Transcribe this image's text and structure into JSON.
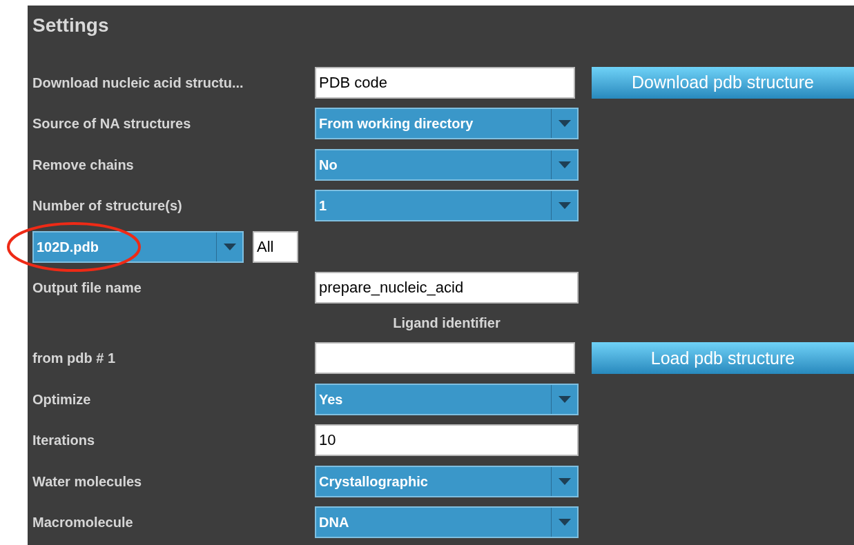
{
  "title": "Settings",
  "rows": [
    {
      "kind": "text",
      "label": "Download nucleic acid structu...",
      "value": "PDB code",
      "button": "Download pdb structure"
    },
    {
      "kind": "select",
      "label": "Source of NA structures",
      "value": "From working directory"
    },
    {
      "kind": "select",
      "label": "Remove chains",
      "value": "No"
    },
    {
      "kind": "select",
      "label": "Number of structure(s)",
      "value": "1"
    },
    {
      "kind": "file",
      "value": "102D.pdb",
      "filter": "All"
    },
    {
      "kind": "text",
      "label": "Output file name",
      "value": "prepare_nucleic_acid"
    },
    {
      "kind": "heading",
      "label": "Ligand identifier"
    },
    {
      "kind": "text",
      "label": "from pdb # 1",
      "button": "Load pdb structure"
    },
    {
      "kind": "select",
      "label": "Optimize",
      "value": "Yes"
    },
    {
      "kind": "text",
      "label": "Iterations",
      "value": "10"
    },
    {
      "kind": "select",
      "label": "Water molecules",
      "value": "Crystallographic"
    },
    {
      "kind": "select",
      "label": "Macromolecule",
      "value": "DNA"
    }
  ]
}
